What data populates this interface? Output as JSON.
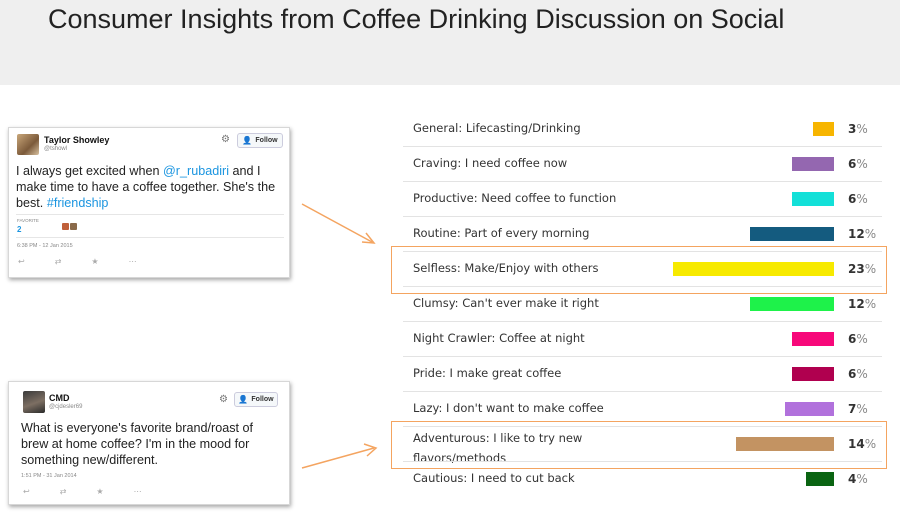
{
  "title": "Consumer Insights from Coffee Drinking Discussion on Social",
  "tweets": [
    {
      "name": "Taylor Showley",
      "handle": "@tshowl",
      "follow": "Follow",
      "text_before": "I always get excited when ",
      "mention": "@r_rubadiri",
      "text_middle": " and I make time to have a coffee together. She's the best. ",
      "hashtag": "#friendship",
      "favorites_label": "FAVORITE",
      "favorites_count": "2",
      "timestamp": "6:38 PM - 12 Jan 2015"
    },
    {
      "name": "CMD",
      "handle": "@cjdesler69",
      "follow": "Follow",
      "text": "What is everyone's favorite brand/roast of brew at home coffee? I'm in the mood for something new/different.",
      "timestamp": "1:51 PM - 31 Jan 2014"
    }
  ],
  "percent_symbol": "%",
  "chart_data": {
    "type": "bar",
    "orientation": "horizontal",
    "categories": [
      [
        "General: Lifecasting/Drinking"
      ],
      [
        "Craving: I need coffee now"
      ],
      [
        "Productive: Need coffee to function"
      ],
      [
        "Routine: Part of every morning"
      ],
      [
        "Selfless: Make/Enjoy with others"
      ],
      [
        "Clumsy: Can't ever make it right"
      ],
      [
        "Night Crawler: Coffee at night"
      ],
      [
        "Pride: I make great coffee"
      ],
      [
        "Lazy: I don't want to make coffee"
      ],
      [
        "Adventurous: I like to try new",
        "flavors/methods"
      ],
      [
        "Cautious: I need to cut back"
      ]
    ],
    "values": [
      3,
      6,
      6,
      12,
      23,
      12,
      6,
      6,
      7,
      14,
      4
    ],
    "colors": [
      "#f7b500",
      "#9467b0",
      "#13e0d8",
      "#145b7f",
      "#f7ea00",
      "#1ef24a",
      "#f7087a",
      "#b0004f",
      "#b171dc",
      "#c39362",
      "#0a6412"
    ],
    "highlighted": [
      4,
      9
    ],
    "highlight_color": "#f4a460"
  }
}
